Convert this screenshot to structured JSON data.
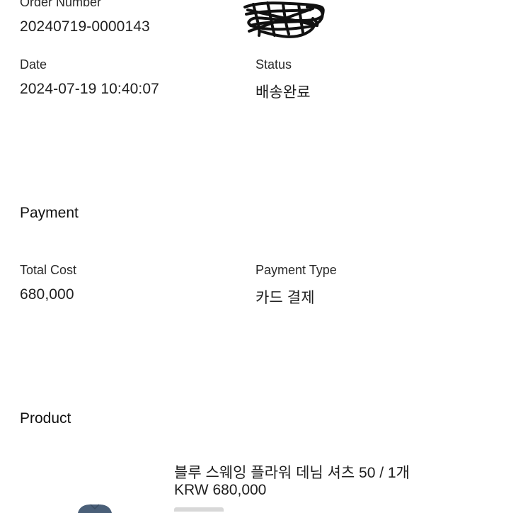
{
  "order": {
    "number_label": "Order Number",
    "number_value": "20240719-0000143",
    "date_label": "Date",
    "date_value": "2024-07-19 10:40:07",
    "status_label": "Status",
    "status_value": "배송완료"
  },
  "payment": {
    "section_title": "Payment",
    "total_cost_label": "Total Cost",
    "total_cost_value": "680,000",
    "payment_type_label": "Payment Type",
    "payment_type_value": "카드 결제"
  },
  "product": {
    "section_title": "Product",
    "name": "블루 스웨잉 플라워 데님 셔츠 50 / 1개",
    "price": "KRW 680,000"
  },
  "colors": {
    "text": "#1f1f1f",
    "background": "#ffffff",
    "redaction": "#111111",
    "product_thumb": "#4a5f78"
  }
}
